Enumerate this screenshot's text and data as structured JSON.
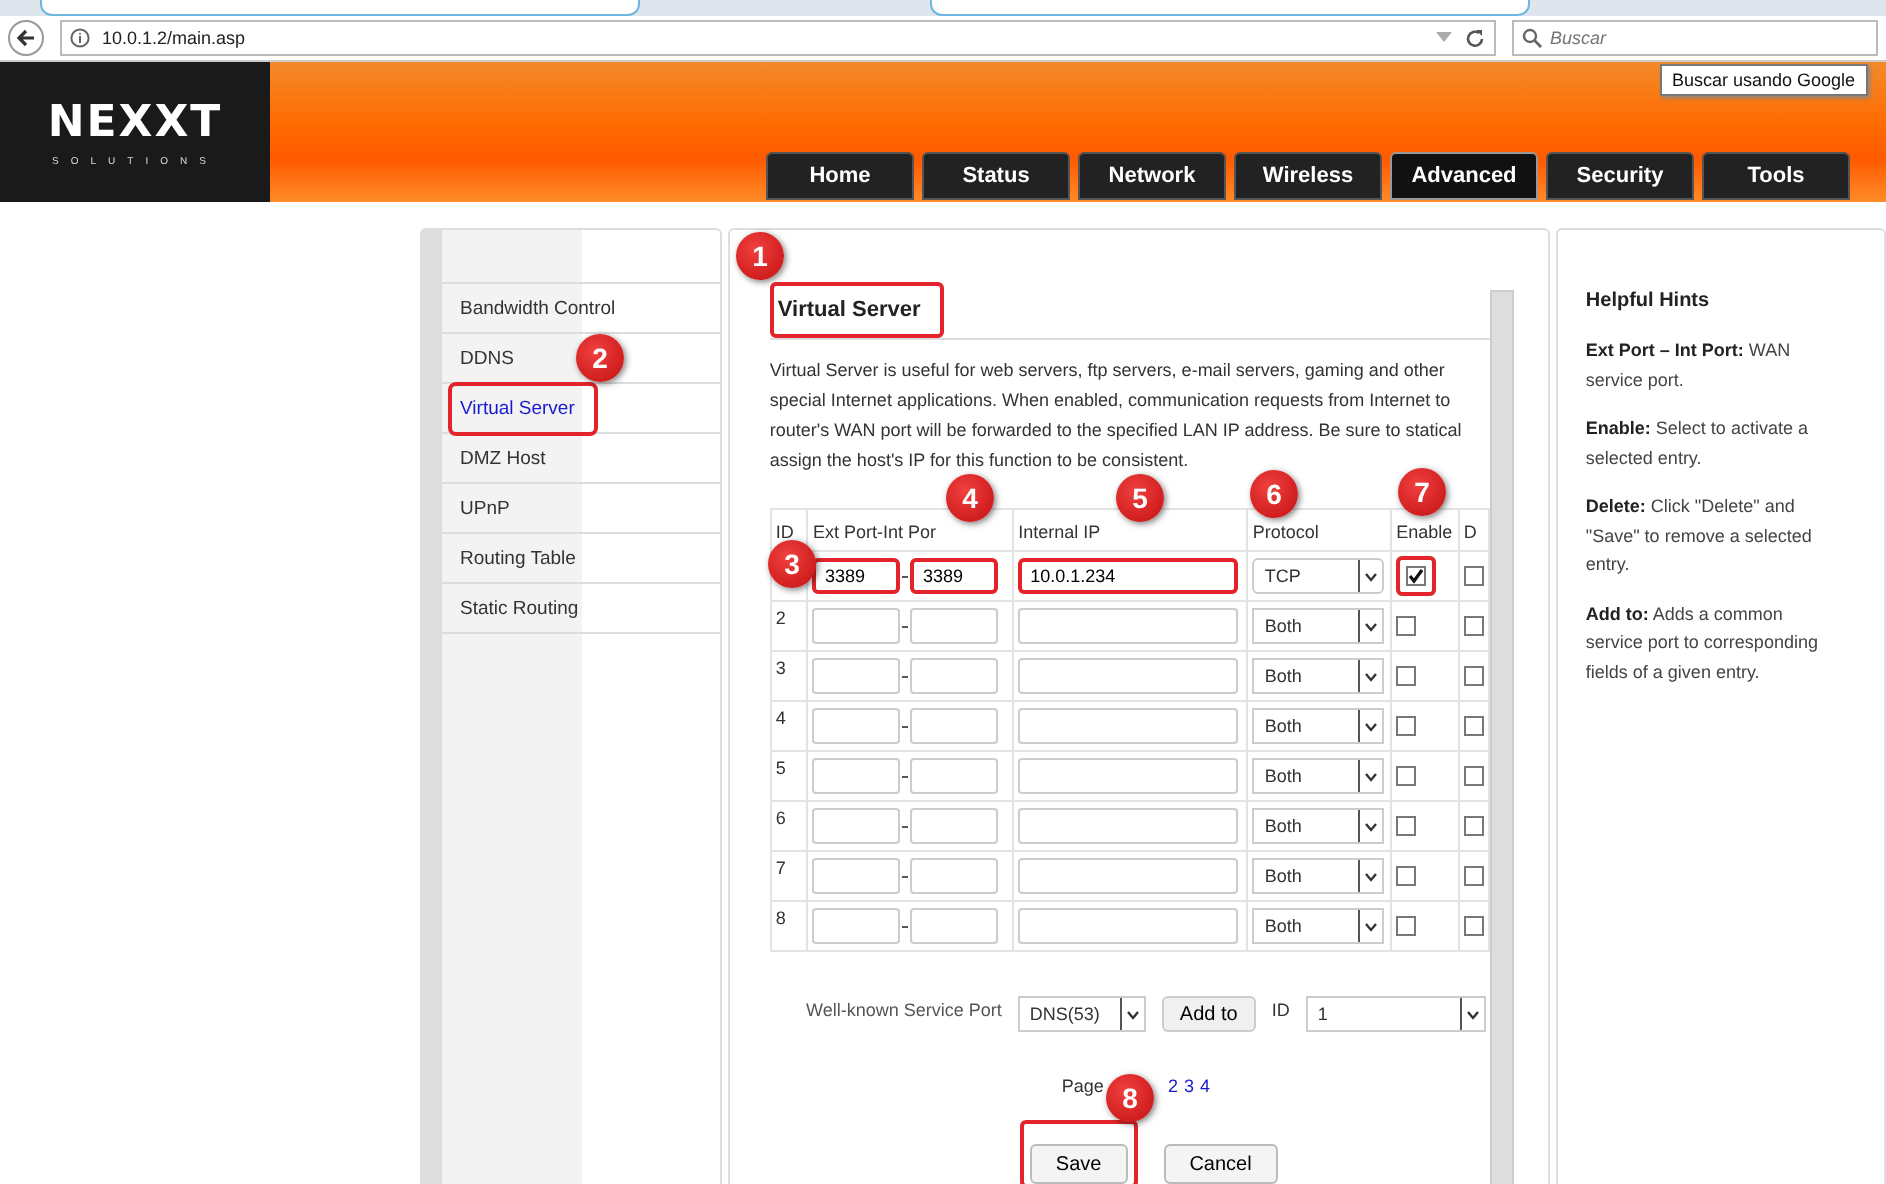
{
  "browser": {
    "address": "10.0.1.2/main.asp",
    "search": {
      "placeholder": "Buscar"
    },
    "tooltip": "Buscar usando Google"
  },
  "logo": {
    "name": "NEXXT",
    "tagline": "SOLUTIONS"
  },
  "nav_tabs": [
    {
      "label": "Home",
      "selected": false
    },
    {
      "label": "Status",
      "selected": false
    },
    {
      "label": "Network",
      "selected": false
    },
    {
      "label": "Wireless",
      "selected": false
    },
    {
      "label": "Advanced",
      "selected": true
    },
    {
      "label": "Security",
      "selected": false
    },
    {
      "label": "Tools",
      "selected": false
    }
  ],
  "sidebar": {
    "items": [
      {
        "label": "Bandwidth Control",
        "selected": false,
        "highlighted": false
      },
      {
        "label": "DDNS",
        "selected": false,
        "highlighted": false
      },
      {
        "label": "Virtual Server",
        "selected": true,
        "highlighted": true
      },
      {
        "label": "DMZ Host",
        "selected": false,
        "highlighted": false
      },
      {
        "label": "UPnP",
        "selected": false,
        "highlighted": false
      },
      {
        "label": "Routing Table",
        "selected": false,
        "highlighted": false
      },
      {
        "label": "Static Routing",
        "selected": false,
        "highlighted": false
      }
    ]
  },
  "panel": {
    "title": "Virtual Server",
    "title_highlighted": true,
    "description": [
      "Virtual Server is useful for web servers, ftp servers, e-mail servers, gaming and other",
      "special Internet applications. When enabled, communication requests from Internet to",
      "router's WAN port will be forwarded to the specified LAN IP address. Be sure to statical",
      "assign the host's IP for this function to be consistent."
    ],
    "columns": [
      "ID",
      "Ext Port-Int Por",
      "Internal IP",
      "Protocol",
      "Enable",
      "D"
    ],
    "rows": [
      {
        "ext_port": "3389",
        "int_port": "3389",
        "internal_ip": "10.0.1.234",
        "protocol": "TCP",
        "enabled": true,
        "delete": false,
        "highlighted": true
      },
      {
        "id": "2",
        "protocol": "Both",
        "enabled": false,
        "delete": false,
        "highlighted": false
      },
      {
        "id": "3",
        "protocol": "Both",
        "enabled": false,
        "delete": false,
        "highlighted": false
      },
      {
        "id": "4",
        "protocol": "Both",
        "enabled": false,
        "delete": false,
        "highlighted": false
      },
      {
        "id": "5",
        "protocol": "Both",
        "enabled": false,
        "delete": false,
        "highlighted": false
      },
      {
        "id": "6",
        "protocol": "Both",
        "enabled": false,
        "delete": false,
        "highlighted": false
      },
      {
        "id": "7",
        "protocol": "Both",
        "enabled": false,
        "delete": false,
        "highlighted": false
      },
      {
        "id": "8",
        "protocol": "Both",
        "enabled": false,
        "delete": false,
        "highlighted": false
      }
    ],
    "well_known": {
      "label": "Well-known Service Port",
      "service": "DNS(53)",
      "add_button": "Add to",
      "id_label": "ID",
      "id_value": "1"
    },
    "pager": {
      "label": "Page",
      "links": [
        "2",
        "3",
        "4"
      ]
    },
    "buttons": [
      {
        "label": "Save",
        "highlighted": true
      },
      {
        "label": "Cancel",
        "highlighted": false
      }
    ]
  },
  "hints": {
    "title": "Helpful Hints",
    "items": [
      "**Ext Port – Int Port:** WAN service port.",
      "**Enable:** Select to activate a selected entry.",
      "**Delete:** Click \"Delete\" and \"Save\" to remove a selected entry.",
      "**Add to:** Adds a common service port to corresponding fields of a given entry."
    ]
  },
  "callouts": [
    "1",
    "2",
    "3",
    "4",
    "5",
    "6",
    "7",
    "8"
  ]
}
